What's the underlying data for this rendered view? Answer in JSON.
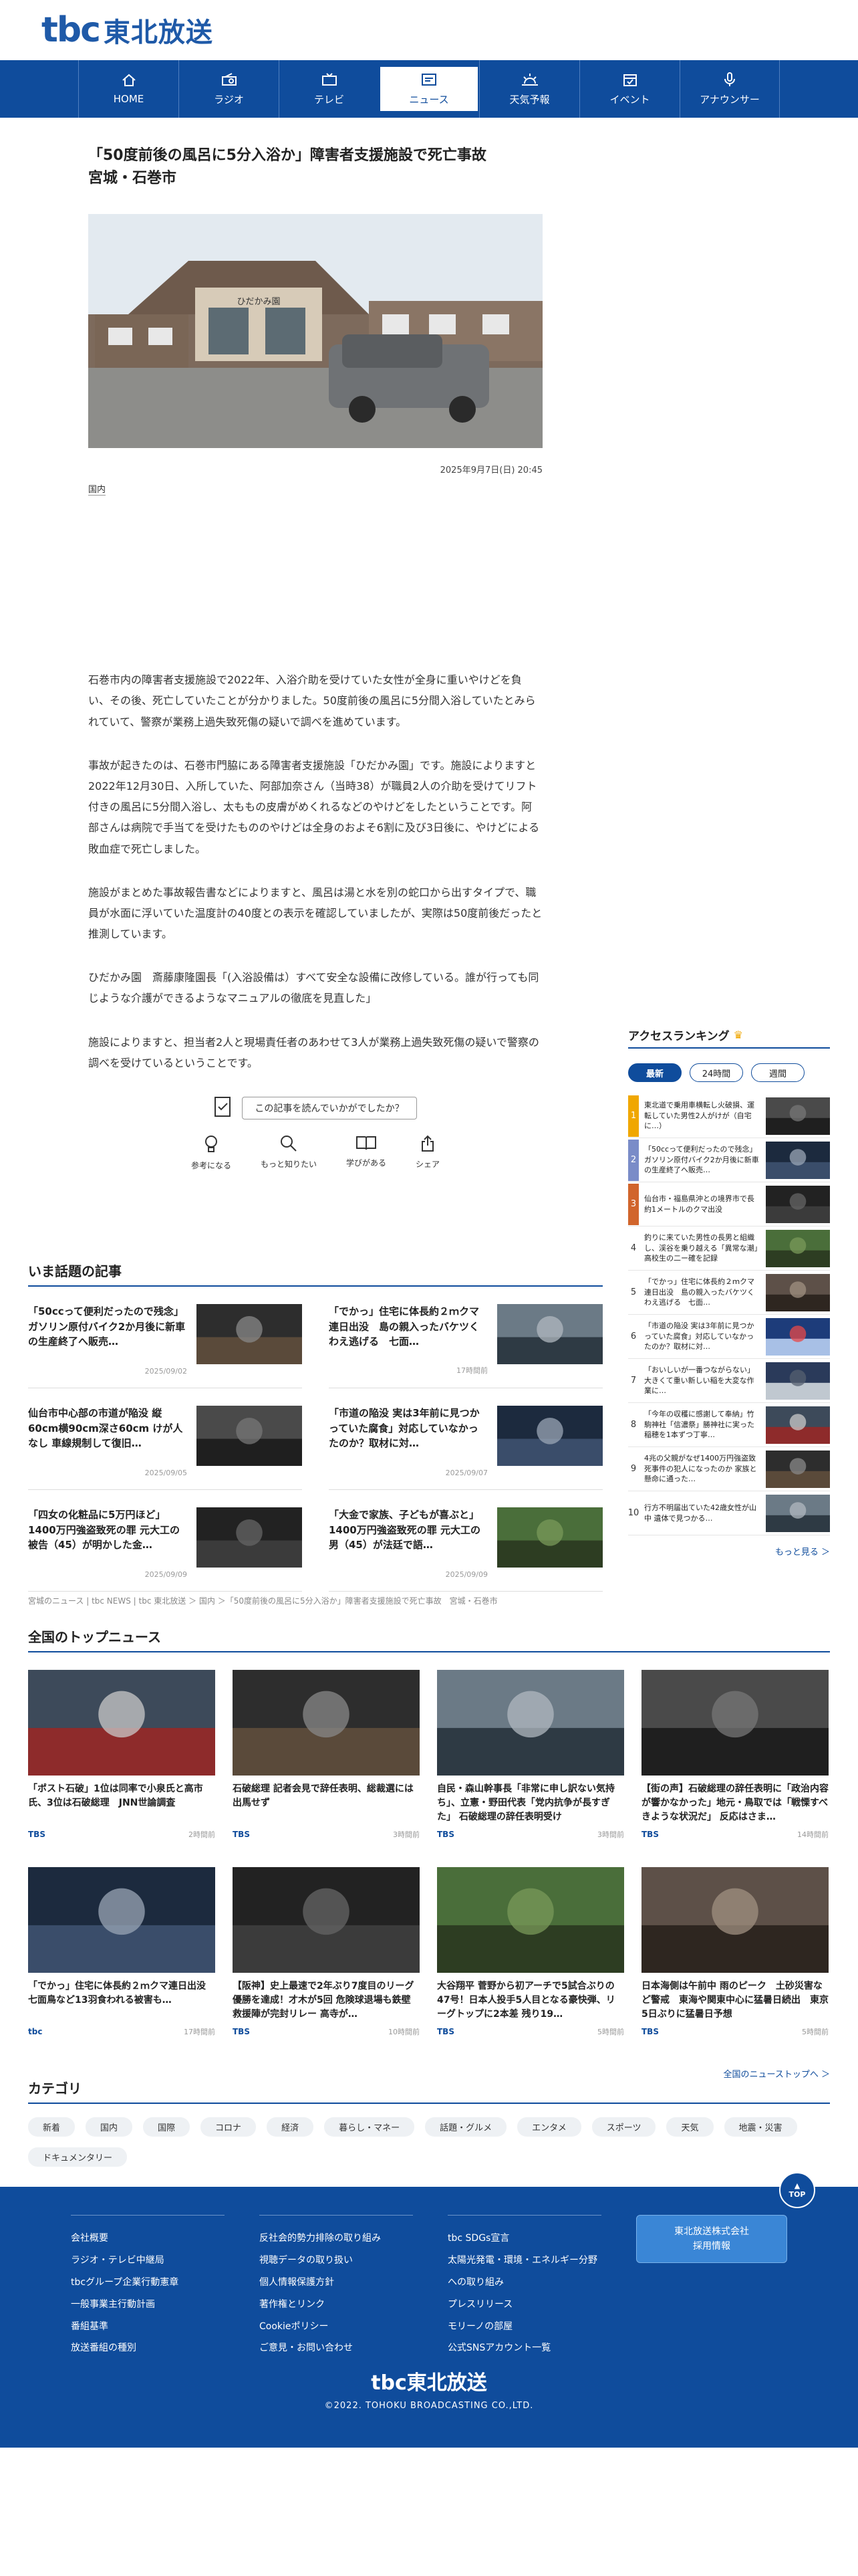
{
  "logo": {
    "mark": "tbc",
    "text": "東北放送"
  },
  "nav": [
    {
      "label": "HOME",
      "icon": "home-icon"
    },
    {
      "label": "ラジオ",
      "icon": "radio-icon"
    },
    {
      "label": "テレビ",
      "icon": "tv-icon"
    },
    {
      "label": "ニュース",
      "icon": "news-icon",
      "active": true
    },
    {
      "label": "天気予報",
      "icon": "weather-icon"
    },
    {
      "label": "イベント",
      "icon": "event-icon"
    },
    {
      "label": "アナウンサー",
      "icon": "mic-icon"
    }
  ],
  "article": {
    "title_line1": "「50度前後の風呂に5分入浴か」障害者支援施設で死亡事故",
    "title_line2": "宮城・石巻市",
    "photo_sign": "ひだかみ園",
    "date": "2025年9月7日(日) 20:45",
    "category": "国内",
    "paragraphs": [
      "石巻市内の障害者支援施設で2022年、入浴介助を受けていた女性が全身に重いやけどを負い、その後、死亡していたことが分かりました。50度前後の風呂に5分間入浴していたとみられていて、警察が業務上過失致死傷の疑いで調べを進めています。",
      "事故が起きたのは、石巻市門脇にある障害者支援施設「ひだかみ園」です。施設によりますと2022年12月30日、入所していた、阿部加奈さん（当時38）が職員2人の介助を受けてリフト付きの風呂に5分間入浴し、太ももの皮膚がめくれるなどのやけどをしたということです。阿部さんは病院で手当てを受けたもののやけどは全身のおよそ6割に及び3日後に、やけどによる敗血症で死亡しました。",
      "施設がまとめた事故報告書などによりますと、風呂は湯と水を別の蛇口から出すタイプで、職員が水面に浮いていた温度計の40度との表示を確認していましたが、実際は50度前後だったと推測しています。",
      "ひだかみ園　斎藤康隆園長「(入浴設備は）すべて安全な設備に改修している。誰が行っても同じような介護ができるようなマニュアルの徹底を見直した」",
      "施設によりますと、担当者2人と現場責任者のあわせて3人が業務上過失致死傷の疑いで警察の調べを受けているということです。"
    ],
    "feedback_question": "この記事を読んでいかがでしたか？",
    "reactions": [
      {
        "label": "参考になる",
        "icon": "lightbulb-icon"
      },
      {
        "label": "もっと知りたい",
        "icon": "magnifier-icon"
      },
      {
        "label": "学びがある",
        "icon": "book-icon"
      },
      {
        "label": "シェア",
        "icon": "share-icon"
      }
    ]
  },
  "trending": {
    "title": "いま話題の記事",
    "items": [
      {
        "title": "「50ccって便利だったので残念」ガソリン原付バイク2か月後に新車の生産終了へ販売…",
        "date": "2025/09/02"
      },
      {
        "title": "「でかっ」住宅に体長約２ｍクマ連日出没　島の親入ったバケツくわえ逃げる　七面…",
        "date": "17時間前"
      },
      {
        "title": "仙台市中心部の市道が陥没 縦60cm横90cm深さ60cm けが人なし 車線規制して復旧…",
        "date": "2025/09/05"
      },
      {
        "title": "「市道の陥没 実は3年前に見つかっていた腐食」対応していなかったのか？取材に対…",
        "date": "2025/09/07"
      },
      {
        "title": "「四女の化粧品に5万円ほど」1400万円強盗致死の罪 元大工の被告（45）が明かした金…",
        "date": "2025/09/09"
      },
      {
        "title": "「大金で家族、子どもが喜ぶと」1400万円強盗致死の罪 元大工の男（45）が法廷で語…",
        "date": "2025/09/09"
      }
    ]
  },
  "breadcrumb": "宮城のニュース | tbc NEWS | tbc 東北放送 ＞ 国内 ＞「50度前後の風呂に5分入浴か」障害者支援施設で死亡事故　宮城・石巻市",
  "ranking": {
    "title": "アクセスランキング",
    "tabs": [
      "最新",
      "24時間",
      "週間"
    ],
    "items": [
      {
        "rank": "1",
        "text": "東北道で乗用車横転し火破損、運転していた男性2人がけが（自宅に…）"
      },
      {
        "rank": "2",
        "text": "「50ccって便利だったので残念」ガソリン原付バイク2か月後に新車の生産終了へ販売…"
      },
      {
        "rank": "3",
        "text": "仙台市・福島県沖との境界市で長約1メートルのクマ出没"
      },
      {
        "rank": "4",
        "text": "釣りに来ていた男性の長男と組織し、渓谷を乗り越える「異常な潮」高校生の二ー確を記録"
      },
      {
        "rank": "5",
        "text": "「でかっ」住宅に体長約２ｍクマ連日出没　島の親入ったバケツくわえ逃げる　七面…"
      },
      {
        "rank": "6",
        "text": "「市道の陥没 実は3年前に見つかっていた腐食」対応していなかったのか？取材に対…"
      },
      {
        "rank": "7",
        "text": "「おいしいが一番つながらない」大きくて重い新しい稲を大変な作業に…"
      },
      {
        "rank": "8",
        "text": "「今年の収穫に感謝して奉納」竹駒神社「信濃祭」勝神社に実った稲穂を1本ずつ丁寧…"
      },
      {
        "rank": "9",
        "text": "4兆の父親がなぜ1400万円強盗致死事件の犯人になったのか 家族と懸命に通った…"
      },
      {
        "rank": "10",
        "text": "行方不明届出ていた42歳女性が山中 遺体で見つかる…"
      }
    ],
    "more": "もっと見る ＞"
  },
  "national": {
    "title": "全国のトップニュース",
    "items": [
      {
        "title": "「ポスト石破」1位は同率で小泉氏と高市氏、3位は石破総理　JNN世論調査",
        "src": "TBS",
        "time": "2時間前"
      },
      {
        "title": "石破総理 記者会見で辞任表明、総裁選には出馬せず",
        "src": "TBS",
        "time": "3時間前"
      },
      {
        "title": "自民・森山幹事長「非常に申し訳ない気持ち」、立憲・野田代表「党内抗争が長すぎた」 石破総理の辞任表明受け",
        "src": "TBS",
        "time": "3時間前"
      },
      {
        "title": "【街の声】石破総理の辞任表明に「政治内容が響かなかった」地元・鳥取では「戦慄すべきような状況だ」 反応はさま…",
        "src": "TBS",
        "time": "14時間前"
      },
      {
        "title": "「でかっ」住宅に体長約２ｍクマ連日出没　七面鳥など13羽食われる被害も…",
        "src": "tbc",
        "time": "17時間前"
      },
      {
        "title": "【阪神】史上最速で2年ぶり7度目のリーグ優勝を達成！才木が5回 危険球退場も鉄壁救援陣が完封リレー 高寺が…",
        "src": "TBS",
        "time": "10時間前"
      },
      {
        "title": "大谷翔平 菅野から初アーチで5試合ぶりの47号！日本人投手5人目となる豪快弾、リーグトップに2本差 残り19…",
        "src": "TBS",
        "time": "5時間前"
      },
      {
        "title": "日本海側は午前中 雨のピーク　土砂災害など警戒　東海や関東中心に猛暑日続出　東京5日ぶりに猛暑日予想",
        "src": "TBS",
        "time": "5時間前"
      }
    ],
    "more": "全国のニューストップへ ＞"
  },
  "categories": {
    "title": "カテゴリ",
    "items": [
      "新着",
      "国内",
      "国際",
      "コロナ",
      "経済",
      "暮らし・マネー",
      "話題・グルメ",
      "エンタメ",
      "スポーツ",
      "天気",
      "地震・災害",
      "ドキュメンタリー"
    ]
  },
  "footer": {
    "to_top": "TOP",
    "col1": [
      "会社概要",
      "ラジオ・テレビ中継局",
      "tbcグループ企業行動憲章",
      "一般事業主行動計画",
      "番組基準",
      "放送番組の種別"
    ],
    "col2": [
      "反社会的勢力排除の取り組み",
      "視聴データの取り扱い",
      "個人情報保護方針",
      "著作権とリンク",
      "Cookieポリシー",
      "ご意見・お問い合わせ"
    ],
    "col3": [
      "tbc SDGs宣言",
      "太陽光発電・環境・エネルギー分野への取り組み",
      "プレスリリース",
      "モリーノの部屋",
      "公式SNSアカウント一覧"
    ],
    "recruit_line1": "東北放送株式会社",
    "recruit_line2": "採用情報",
    "logo": "tbc東北放送",
    "copyright": "©2022. TOHOKU BROADCASTING CO.,LTD."
  },
  "colors": {
    "brand": "#0f4c9c",
    "accent": "#f0a700"
  }
}
